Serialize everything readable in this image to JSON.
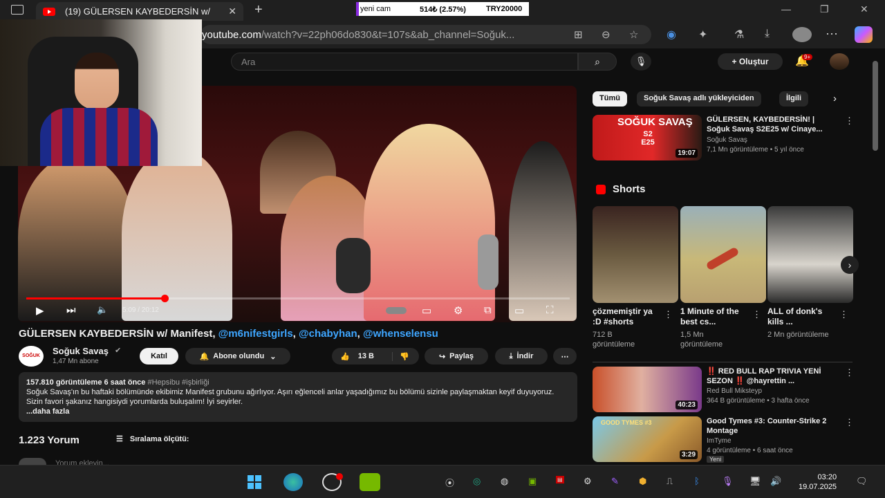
{
  "browser": {
    "tab_title": "(19) GÜLERSEN KAYBEDERSİN w/",
    "new_tab": "+",
    "url_host": "youtube.com",
    "url_path": "/watch?v=22ph06do830&t=107s&ab_channel=Soğuk...",
    "ticker": {
      "label": "yeni cam",
      "value": "514₺ (2.57%)",
      "goal": "TRY20000"
    }
  },
  "youtube": {
    "search_placeholder": "Ara",
    "create_label": "Oluştur",
    "notif_count": "9+",
    "video": {
      "time": "5:09 / 20:12",
      "progress_fraction": 0.255,
      "title": "GÜLERSEN KAYBEDERSİN w/ Manifest,",
      "mentions": [
        "@m6nifestgirls",
        "@chabyhan",
        "@whenselensu"
      ],
      "channel": "Soğuk Savaş",
      "channel_logo": "SOĞUK SAVAŞ",
      "subs": "1,47 Mn abone",
      "join": "Katıl",
      "subscribed": "Abone olundu",
      "likes": "13 B",
      "share": "Paylaş",
      "download": "İndir",
      "description": {
        "stats": "157.810 görüntüleme  6 saat önce",
        "tags": "#Hepsibu #işbirliği",
        "text": "Soğuk Savaş'ın bu haftaki bölümünde ekibimiz Manifest grubunu ağırlıyor. Aşırı eğlenceli anlar yaşadığımız bu bölümü sizinle paylaşmaktan keyif duyuyoruz. Sizin favori şakanız hangisiydi yorumlarda buluşalım! İyi seyirler.",
        "more": "...daha fazla"
      },
      "comments_count": "1.223 Yorum",
      "sort_label": "Sıralama ölçütü:",
      "add_comment": "Yorum ekleyin..."
    },
    "chips": [
      "Tümü",
      "Soğuk Savaş adlı yükleyiciden",
      "İlgili"
    ],
    "related": [
      {
        "title": "GÜLERSEN, KAYBEDERSİN! | Soğuk Savaş S2E25 w/ Cinaye...",
        "channel": "Soğuk Savaş",
        "meta": "7,1 Mn görüntüleme • 5 yıl önce",
        "duration": "19:07",
        "thumb_text": "SOĞUK SAVAŞ",
        "thumb_sub": "S2 E25"
      },
      {
        "title": "‼️ RED BULL RAP TRIVIA YENİ SEZON ‼️ @hayrettin ...",
        "channel": "Red Bull Miksteyp",
        "meta": "364 B görüntüleme • 3 hafta önce",
        "duration": "40:23"
      },
      {
        "title": "Good Tymes #3: Counter-Strike 2 Montage",
        "channel": "ImTyme",
        "meta": "4 görüntüleme • 6 saat önce",
        "duration": "3:29",
        "badge": "Yeni",
        "thumb_text": "GOOD TYMES #3"
      }
    ],
    "shorts_title": "Shorts",
    "shorts": [
      {
        "title": "çözmemiştir ya :D #shorts",
        "views": "712 B görüntüleme"
      },
      {
        "title": "1 Minute of the best cs...",
        "views": "1,5 Mn görüntüleme"
      },
      {
        "title": "ALL of donk's kills ...",
        "views": "2 Mn görüntüleme"
      }
    ]
  },
  "taskbar": {
    "time": "03:20",
    "date": "19.07.2025"
  }
}
